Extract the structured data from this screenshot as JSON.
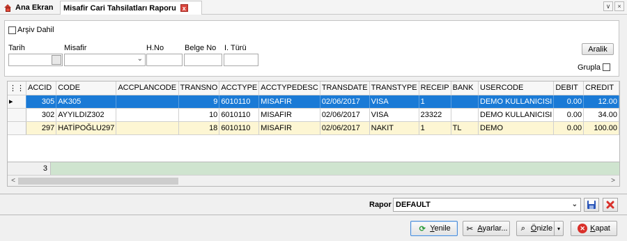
{
  "tabs": {
    "home_label": "Ana Ekran",
    "report_label": "Misafir Cari Tahsilatları Raporu",
    "close_glyph": "x"
  },
  "window": {
    "dropdown_glyph": "∨",
    "close_glyph": "×"
  },
  "filter": {
    "archive_label": "Arşiv Dahil",
    "tarih_label": "Tarih",
    "misafir_label": "Misafir",
    "hno_label": "H.No",
    "belgeno_label": "Belge No",
    "ituru_label": "I. Türü",
    "aralik_label": "Aralik",
    "grupla_label": "Grupla"
  },
  "grid": {
    "columns": [
      "ACCID",
      "CODE",
      "ACCPLANCODE",
      "TRANSNO",
      "ACCTYPE",
      "ACCTYPEDESC",
      "TRANSDATE",
      "TRANSTYPE",
      "RECEIP",
      "BANK",
      "USERCODE",
      "DEBIT",
      "CREDIT"
    ],
    "rows": [
      [
        "305",
        "AK305",
        "",
        "9",
        "6010110",
        "MISAFIR",
        "02/06/2017",
        "VISA",
        "1",
        "",
        "DEMO KULLANICISI",
        "0.00",
        "12.00"
      ],
      [
        "302",
        "AYYILDIZ302",
        "",
        "10",
        "6010110",
        "MISAFIR",
        "02/06/2017",
        "VISA",
        "23322",
        "",
        "DEMO KULLANICISI",
        "0.00",
        "34.00"
      ],
      [
        "297",
        "HATİPOĞLU297",
        "",
        "18",
        "6010110",
        "MISAFIR",
        "02/06/2017",
        "NAKIT",
        "1",
        "TL",
        "DEMO",
        "0.00",
        "100.00"
      ]
    ],
    "footer_count": "3"
  },
  "report": {
    "label": "Rapor",
    "selected": "DEFAULT"
  },
  "buttons": {
    "yenile_pre": "",
    "yenile_u": "Y",
    "yenile_post": "enile",
    "ayarlar_pre": "",
    "ayarlar_u": "A",
    "ayarlar_post": "yarlar...",
    "onizle_pre": "",
    "onizle_u": "Ö",
    "onizle_post": "nizle",
    "kapat_pre": "",
    "kapat_u": "K",
    "kapat_post": "apat"
  },
  "colors": {
    "selection": "#1a7ad6",
    "footer": "#cfe4cf",
    "accent_red": "#d9463d"
  }
}
